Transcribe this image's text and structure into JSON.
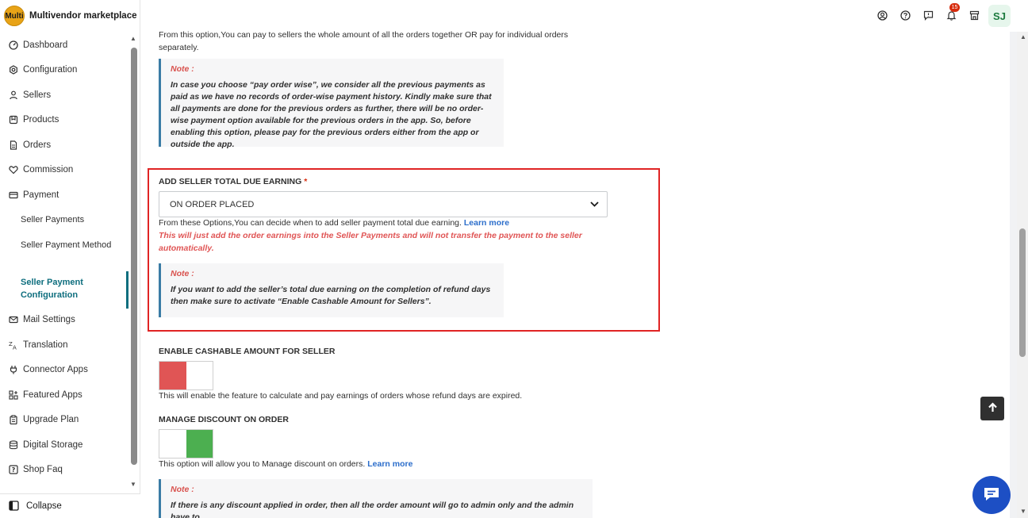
{
  "brand": {
    "logo_text": "Multi",
    "name": "Multivendor marketplace"
  },
  "sidebar": {
    "items": [
      {
        "label": "Dashboard",
        "icon": "dashboard-icon"
      },
      {
        "label": "Configuration",
        "icon": "gear-icon"
      },
      {
        "label": "Sellers",
        "icon": "person-icon"
      },
      {
        "label": "Products",
        "icon": "product-icon"
      },
      {
        "label": "Orders",
        "icon": "orders-icon"
      },
      {
        "label": "Commission",
        "icon": "commission-icon"
      },
      {
        "label": "Payment",
        "icon": "payment-icon"
      },
      {
        "label": "Mail Settings",
        "icon": "mail-icon"
      },
      {
        "label": "Translation",
        "icon": "translation-icon"
      },
      {
        "label": "Connector Apps",
        "icon": "plug-icon"
      },
      {
        "label": "Featured Apps",
        "icon": "apps-icon"
      },
      {
        "label": "Upgrade Plan",
        "icon": "upgrade-icon"
      },
      {
        "label": "Digital Storage",
        "icon": "storage-icon"
      },
      {
        "label": "Shop Faq",
        "icon": "faq-icon"
      }
    ],
    "payment_sub": [
      {
        "label": "Seller Payments"
      },
      {
        "label": "Seller Payment Method"
      },
      {
        "label": "Seller Payment Configuration",
        "active": true
      }
    ],
    "collapse_label": "Collapse"
  },
  "topbar": {
    "icons": [
      "account-icon",
      "help-icon",
      "feedback-icon",
      "notification-icon",
      "store-icon"
    ],
    "notification_count": "15",
    "avatar_initials": "SJ"
  },
  "main": {
    "intro_text": "From this option,You can pay to sellers the whole amount of all the orders together OR pay for individual orders separately.",
    "note1": {
      "title": "Note :",
      "text": "In case you choose “pay order wise”, we consider all the previous payments as paid as we have no records of order-wise payment history. Kindly make sure that all payments are done for the previous orders as further, there will be no order-wise payment option available for the previous orders in the app. So, before enabling this option, please pay for the previous orders either from the app or outside the app."
    },
    "due_earning": {
      "label": "ADD SELLER TOTAL DUE EARNING",
      "required_mark": "*",
      "selected": "ON ORDER PLACED",
      "help_text": "From these Options,You can decide when to add seller payment total due earning.",
      "learn_more": "Learn more",
      "warning": "This will just add the order earnings into the Seller Payments and will not transfer the payment to the seller automatically.",
      "note_title": "Note :",
      "note_text": "If you want to add the seller’s total due earning on the completion of refund days then make sure to activate “Enable Cashable Amount for Sellers”."
    },
    "cashable": {
      "label": "ENABLE CASHABLE AMOUNT FOR SELLER",
      "enabled": false,
      "help_text": "This will enable the feature to calculate and pay earnings of orders whose refund days are expired."
    },
    "discount": {
      "label": "MANAGE DISCOUNT ON ORDER",
      "enabled": true,
      "help_text": "This option will allow you to Manage discount on orders.",
      "learn_more": "Learn more",
      "note_title": "Note :",
      "note_text": "If there is any discount applied in order, then all the order amount will go to admin only and the admin have to"
    }
  },
  "colors": {
    "accent": "#0e6e7e",
    "highlight_border": "#e02424",
    "toggle_off": "#e05555",
    "toggle_on": "#4caf50",
    "link": "#2c6ecb",
    "chat": "#1d4fc4"
  }
}
